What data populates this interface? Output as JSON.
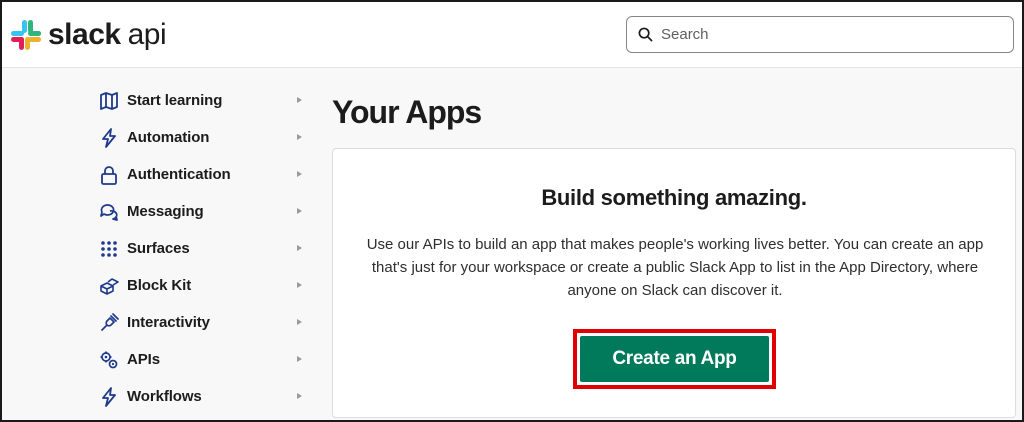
{
  "header": {
    "logo_brand": "slack",
    "logo_product": "api",
    "search": {
      "placeholder": "Search",
      "icon": "search-icon"
    }
  },
  "sidebar": {
    "items": [
      {
        "label": "Start learning",
        "icon": "map-icon"
      },
      {
        "label": "Automation",
        "icon": "lightning-icon"
      },
      {
        "label": "Authentication",
        "icon": "lock-icon"
      },
      {
        "label": "Messaging",
        "icon": "message-bubbles-icon"
      },
      {
        "label": "Surfaces",
        "icon": "grid-dots-icon"
      },
      {
        "label": "Block Kit",
        "icon": "blocks-icon"
      },
      {
        "label": "Interactivity",
        "icon": "plug-icon"
      },
      {
        "label": "APIs",
        "icon": "gears-icon"
      },
      {
        "label": "Workflows",
        "icon": "lightning-icon"
      }
    ]
  },
  "main": {
    "title": "Your Apps",
    "card": {
      "heading": "Build something amazing.",
      "body": "Use our APIs to build an app that makes people's working lives better. You can create an app that's just for your workspace or create a public Slack App to list in the App Directory, where anyone on Slack can discover it.",
      "cta_label": "Create an App"
    }
  },
  "colors": {
    "cta_background": "#007a5a",
    "cta_highlight_border": "#e10000",
    "text_primary": "#1d1c1d"
  }
}
